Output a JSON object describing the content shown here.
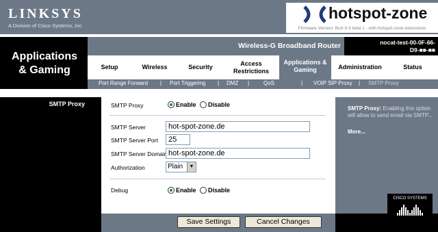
{
  "header": {
    "brand": "LINKSYS",
    "brand_sub": "A Division of Cisco Systems, Inc.",
    "hotspot_name": "hotspot-zone",
    "firmware": "Firmware Version: Burt 0-3 beta 1 - with hotspot-zone extensions",
    "section_title_line1": "Applications",
    "section_title_line2": "& Gaming",
    "product_name": "Wireless-G Broadband Router",
    "device_name_line1": "nocat-test-00-0F-66-",
    "device_name_line2": "D9-■■-■■"
  },
  "tabs": [
    {
      "label": "Setup"
    },
    {
      "label": "Wireless"
    },
    {
      "label": "Security"
    },
    {
      "label": "Access Restrictions"
    },
    {
      "label": "Applications & Gaming"
    },
    {
      "label": "Administration"
    },
    {
      "label": "Status"
    }
  ],
  "subtabs": [
    {
      "label": "Port Range Forward"
    },
    {
      "label": "Port Triggering"
    },
    {
      "label": "DMZ"
    },
    {
      "label": "QoS"
    },
    {
      "label": "VOIP SIP Proxy"
    },
    {
      "label": "SMTP Proxy"
    }
  ],
  "section_label": "SMTP Proxy",
  "form": {
    "smtp_proxy_label": "SMTP Proxy",
    "enable_label": "Enable",
    "disable_label": "Disable",
    "smtp_server_label": "SMTP Server",
    "smtp_server_value": "hot-spot-zone.de",
    "smtp_port_label": "SMTP Server Port",
    "smtp_port_value": "25",
    "smtp_domain_label": "SMTP Server Domain",
    "smtp_domain_value": "hot-spot-zone.de",
    "auth_label": "Authorization",
    "auth_value": "Plain",
    "debug_label": "Debug",
    "debug_enable_label": "Enable",
    "debug_disable_label": "Disable"
  },
  "help": {
    "title": "SMTP Proxy:",
    "text": " Enabling this option will allow to send email via SMTP...",
    "more": "More..."
  },
  "cisco": "CISCO SYSTEMS",
  "buttons": {
    "save": "Save Settings",
    "cancel": "Cancel Changes"
  },
  "colors": {
    "grey": "#6d7887",
    "black": "#000000"
  }
}
